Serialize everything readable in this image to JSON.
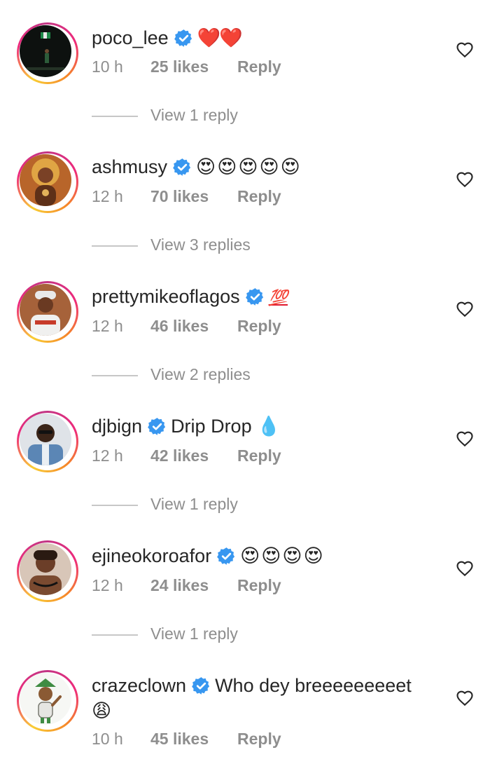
{
  "comments": [
    {
      "username": "poco_lee",
      "text": "❤️❤️",
      "time": "10 h",
      "likes": "25 likes",
      "reply": "Reply",
      "view_replies": "View 1 reply",
      "avatar": "avatar-flag-person"
    },
    {
      "username": "ashmusy",
      "text": "😍😍😍😍😍",
      "time": "12 h",
      "likes": "70 likes",
      "reply": "Reply",
      "view_replies": "View 3 replies",
      "avatar": "avatar-crown-woman"
    },
    {
      "username": "prettymikeoflagos",
      "text": "💯",
      "time": "12 h",
      "likes": "46 likes",
      "reply": "Reply",
      "view_replies": "View 2 replies",
      "avatar": "avatar-cap-man"
    },
    {
      "username": "djbign",
      "text": "Drip Drop 💧",
      "time": "12 h",
      "likes": "42 likes",
      "reply": "Reply",
      "view_replies": "View 1 reply",
      "avatar": "avatar-denim-man"
    },
    {
      "username": "ejineokoroafor",
      "text": "😍😍😍😍",
      "time": "12 h",
      "likes": "24 likes",
      "reply": "Reply",
      "view_replies": "View 1 reply",
      "avatar": "avatar-woman"
    },
    {
      "username": "crazeclown",
      "text": "Who dey breeeeeeeeet",
      "text_line2": "😩",
      "time": "10 h",
      "likes": "45 likes",
      "reply": "Reply",
      "avatar": "avatar-cartoon"
    }
  ],
  "colors": {
    "verified": "#3897f0",
    "meta": "#8e8e8e",
    "text": "#262626",
    "heart_emoji": "#e0182d"
  },
  "icons": {
    "verified": "verified-badge-icon",
    "like": "heart-outline-icon"
  }
}
